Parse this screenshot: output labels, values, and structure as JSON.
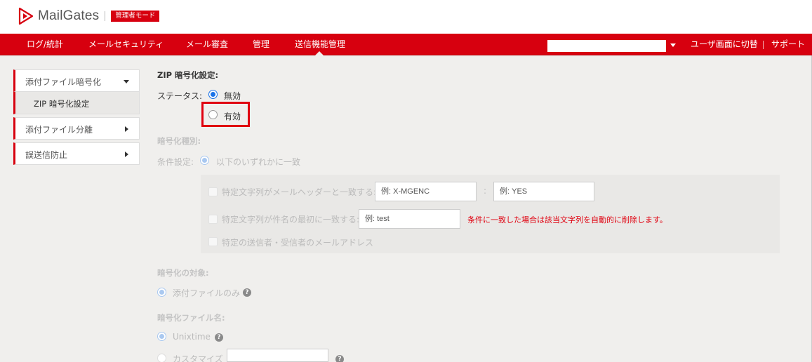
{
  "header": {
    "logo_text": "MailGates",
    "admin_badge": "管理者モード"
  },
  "nav": {
    "items": [
      "ログ/統計",
      "メールセキュリティ",
      "メール審査",
      "管理",
      "送信機能管理"
    ],
    "active_index": 4,
    "switch_user_view": "ユーザ画面に切替",
    "support": "サポート",
    "domain_select_value": ""
  },
  "sidebar": {
    "items": [
      {
        "label": "添付ファイル暗号化",
        "expanded": true
      },
      {
        "label": "添付ファイル分離",
        "expanded": false
      },
      {
        "label": "誤送信防止",
        "expanded": false
      }
    ],
    "sub_items": [
      "ZIP 暗号化設定"
    ]
  },
  "form": {
    "section_title": "ZIP 暗号化設定:",
    "status_label": "ステータス:",
    "status_options": [
      {
        "label": "無効",
        "checked": true
      },
      {
        "label": "有効",
        "checked": false
      }
    ],
    "encryption_type_title": "暗号化種別:",
    "condition_label": "条件設定:",
    "condition_option": "以下のいずれかに一致",
    "conditions": {
      "header_match_label": "特定文字列がメールヘッダーと一致する:",
      "header_name_placeholder": "例: X-MGENC",
      "header_sep": ":",
      "header_value_placeholder": "例: YES",
      "subject_prefix_label": "特定文字列が件名の最初に一致する:",
      "subject_placeholder": "例: test",
      "subject_note": "条件に一致した場合は該当文字列を自動的に削除します。",
      "sender_recipient_label": "特定の送信者・受信者のメールアドレス"
    },
    "target_title": "暗号化の対象:",
    "target_option": "添付ファイルのみ",
    "filename_title": "暗号化ファイル名:",
    "filename_options": [
      {
        "label": "Unixtime",
        "checked": true
      },
      {
        "label": "カスタマイズ",
        "checked": false
      }
    ],
    "help_glyph": "?"
  },
  "colors": {
    "brand_red": "#d7000f",
    "radio_blue": "#1a73e8",
    "highlight_red": "#e0000f"
  }
}
